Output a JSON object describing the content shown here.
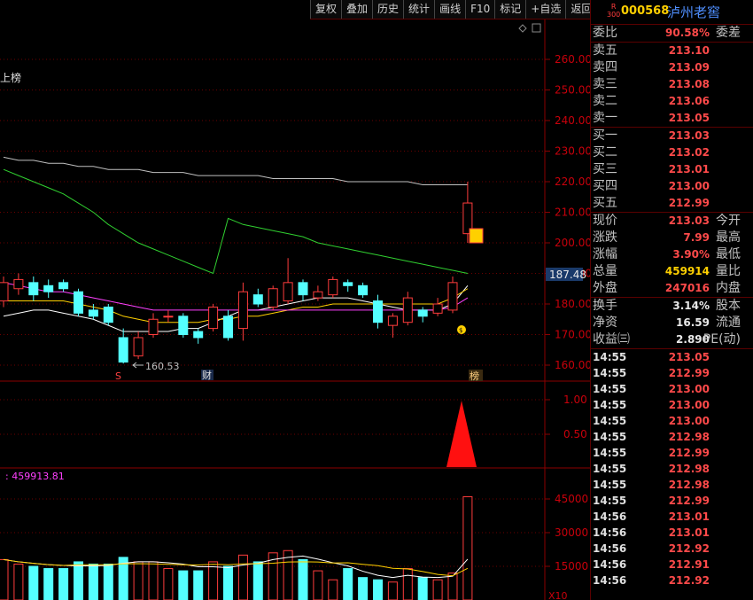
{
  "toolbar": {
    "buttons": [
      "复权",
      "叠加",
      "历史",
      "统计",
      "画线",
      "F10",
      "标记",
      "+自选",
      "返回"
    ]
  },
  "stock": {
    "badge_top": "R",
    "badge_bottom": "300",
    "code": "000568",
    "name": "泸州老窖"
  },
  "chart": {
    "price_axis": [
      "260.00",
      "250.00",
      "240.00",
      "230.00",
      "220.00",
      "210.00",
      "200.00",
      "190.00",
      "180.00",
      "170.00",
      "160.00"
    ],
    "current_price_tag": "187.48",
    "left_label": "上榜",
    "low_marker": "160.53",
    "markers": {
      "s": "S",
      "cai": "财",
      "bang": "榜"
    },
    "indicator_axis": [
      "1.00",
      "0.50"
    ],
    "volume_value": ": 459913.81",
    "volume_axis": [
      "45000",
      "30000",
      "15000"
    ],
    "volume_unit": "X10",
    "colors": {
      "up": "#ff3c3c",
      "down": "#54ffff",
      "ma5": "#ffffff",
      "ma10": "#ffd000",
      "ma20": "#ff40ff",
      "ma60": "#30d030",
      "ma120": "#c0c0c0",
      "grid": "#6b0000"
    }
  },
  "chart_data": {
    "type": "candlestick",
    "ylim": [
      155,
      265
    ],
    "candles": [
      {
        "o": 181,
        "c": 187,
        "h": 189,
        "l": 179
      },
      {
        "o": 185,
        "c": 188,
        "h": 190,
        "l": 183
      },
      {
        "o": 187,
        "c": 183,
        "h": 189,
        "l": 181
      },
      {
        "o": 186,
        "c": 184,
        "h": 188,
        "l": 182
      },
      {
        "o": 187,
        "c": 185,
        "h": 188,
        "l": 184
      },
      {
        "o": 184,
        "c": 177,
        "h": 185,
        "l": 176
      },
      {
        "o": 178,
        "c": 176,
        "h": 180,
        "l": 175
      },
      {
        "o": 179,
        "c": 174,
        "h": 180,
        "l": 173
      },
      {
        "o": 169,
        "c": 161,
        "h": 172,
        "l": 160.53
      },
      {
        "o": 163,
        "c": 169,
        "h": 171,
        "l": 162
      },
      {
        "o": 170,
        "c": 175,
        "h": 177,
        "l": 169
      },
      {
        "o": 176,
        "c": 176,
        "h": 178,
        "l": 174
      },
      {
        "o": 176,
        "c": 170,
        "h": 177,
        "l": 169
      },
      {
        "o": 171,
        "c": 169,
        "h": 172,
        "l": 167
      },
      {
        "o": 172,
        "c": 179,
        "h": 180,
        "l": 171
      },
      {
        "o": 176,
        "c": 169,
        "h": 178,
        "l": 168
      },
      {
        "o": 172,
        "c": 184,
        "h": 187,
        "l": 168
      },
      {
        "o": 183,
        "c": 180,
        "h": 185,
        "l": 179
      },
      {
        "o": 179,
        "c": 185,
        "h": 186,
        "l": 178
      },
      {
        "o": 181,
        "c": 187,
        "h": 195,
        "l": 180
      },
      {
        "o": 187,
        "c": 183,
        "h": 188,
        "l": 181
      },
      {
        "o": 182,
        "c": 184,
        "h": 186,
        "l": 181
      },
      {
        "o": 183,
        "c": 188,
        "h": 189,
        "l": 182
      },
      {
        "o": 187,
        "c": 186,
        "h": 188,
        "l": 184
      },
      {
        "o": 186,
        "c": 183,
        "h": 187,
        "l": 182
      },
      {
        "o": 181,
        "c": 174,
        "h": 183,
        "l": 172
      },
      {
        "o": 173,
        "c": 176,
        "h": 177,
        "l": 169
      },
      {
        "o": 174,
        "c": 182,
        "h": 184,
        "l": 173
      },
      {
        "o": 178,
        "c": 176,
        "h": 179,
        "l": 174
      },
      {
        "o": 177,
        "c": 180,
        "h": 182,
        "l": 176
      },
      {
        "o": 178,
        "c": 187,
        "h": 189,
        "l": 177
      },
      {
        "o": 203,
        "c": 213.03,
        "h": 220,
        "l": 200
      }
    ],
    "ma": {
      "ma5": [
        176,
        177,
        178,
        178,
        177,
        176,
        175,
        173,
        171,
        171,
        171,
        171,
        172,
        172,
        174,
        176,
        178,
        178,
        179,
        180,
        181,
        182,
        182,
        182,
        181,
        180,
        179,
        178,
        178,
        178,
        180,
        186
      ],
      "ma10": [
        181,
        181,
        181,
        181,
        181,
        180,
        179,
        178,
        176,
        175,
        174,
        174,
        174,
        174,
        175,
        175,
        176,
        176,
        177,
        178,
        179,
        179,
        180,
        180,
        180,
        180,
        180,
        180,
        180,
        180,
        182,
        185
      ],
      "ma20": [
        187,
        186,
        185,
        184,
        184,
        183,
        182,
        181,
        180,
        179,
        178,
        178,
        178,
        178,
        178,
        178,
        178,
        178,
        178,
        178,
        178,
        178,
        178,
        178,
        178,
        178,
        178,
        178,
        178,
        178,
        179,
        182
      ],
      "ma60": [
        224,
        222,
        220,
        218,
        216,
        213,
        210,
        206,
        203,
        200,
        198,
        196,
        194,
        192,
        190,
        208,
        206,
        205,
        204,
        203,
        202,
        200,
        199,
        198,
        197,
        196,
        195,
        194,
        193,
        192,
        191,
        190
      ],
      "ma120": [
        228,
        227,
        227,
        226,
        226,
        225,
        225,
        224,
        224,
        224,
        223,
        223,
        223,
        222,
        222,
        222,
        222,
        222,
        221,
        221,
        221,
        221,
        221,
        220,
        220,
        220,
        220,
        220,
        219,
        219,
        219,
        219
      ]
    },
    "volume": {
      "ylim": [
        0,
        48000
      ],
      "values": [
        18000,
        16000,
        15000,
        14000,
        14000,
        17000,
        16000,
        16000,
        19000,
        17000,
        17000,
        14000,
        13000,
        13000,
        17000,
        15000,
        20000,
        17000,
        21000,
        22000,
        18000,
        13000,
        9000,
        14000,
        10000,
        9000,
        8000,
        14000,
        10000,
        9000,
        12000,
        46000
      ]
    }
  },
  "panel": {
    "weibi": {
      "label": "委比",
      "value": "90.58%",
      "label2": "委差"
    },
    "asks": [
      {
        "label": "卖五",
        "price": "213.10"
      },
      {
        "label": "卖四",
        "price": "213.09"
      },
      {
        "label": "卖三",
        "price": "213.08"
      },
      {
        "label": "卖二",
        "price": "213.06"
      },
      {
        "label": "卖一",
        "price": "213.05"
      }
    ],
    "bids": [
      {
        "label": "买一",
        "price": "213.03"
      },
      {
        "label": "买二",
        "price": "213.02"
      },
      {
        "label": "买三",
        "price": "213.01"
      },
      {
        "label": "买四",
        "price": "213.00"
      },
      {
        "label": "买五",
        "price": "212.99"
      }
    ],
    "quote": [
      {
        "label": "现价",
        "value": "213.03",
        "label2": "今开",
        "color": "red"
      },
      {
        "label": "涨跌",
        "value": "7.99",
        "label2": "最高",
        "color": "red"
      },
      {
        "label": "涨幅",
        "value": "3.90%",
        "label2": "最低",
        "color": "red"
      },
      {
        "label": "总量",
        "value": "459914",
        "label2": "量比",
        "color": "yel"
      },
      {
        "label": "外盘",
        "value": "247016",
        "label2": "内盘",
        "color": "red"
      }
    ],
    "finance": [
      {
        "label": "换手",
        "value": "3.14%",
        "label2": "股本"
      },
      {
        "label": "净资",
        "value": "16.59",
        "label2": "流通"
      },
      {
        "label": "收益㈢",
        "value": "2.890",
        "label2": "PE(动)"
      }
    ],
    "ticks": [
      {
        "time": "14:55",
        "price": "213.05",
        "color": "red"
      },
      {
        "time": "14:55",
        "price": "212.99",
        "color": "red"
      },
      {
        "time": "14:55",
        "price": "213.00",
        "color": "red"
      },
      {
        "time": "14:55",
        "price": "213.00",
        "color": "red"
      },
      {
        "time": "14:55",
        "price": "213.00",
        "color": "red"
      },
      {
        "time": "14:55",
        "price": "212.98",
        "color": "red"
      },
      {
        "time": "14:55",
        "price": "212.99",
        "color": "red"
      },
      {
        "time": "14:55",
        "price": "212.98",
        "color": "red"
      },
      {
        "time": "14:55",
        "price": "212.98",
        "color": "red"
      },
      {
        "time": "14:55",
        "price": "212.99",
        "color": "red"
      },
      {
        "time": "14:56",
        "price": "213.01",
        "color": "red"
      },
      {
        "time": "14:56",
        "price": "213.01",
        "color": "red"
      },
      {
        "time": "14:56",
        "price": "212.92",
        "color": "red"
      },
      {
        "time": "14:56",
        "price": "212.91",
        "color": "red"
      },
      {
        "time": "14:56",
        "price": "212.92",
        "color": "red"
      }
    ]
  }
}
